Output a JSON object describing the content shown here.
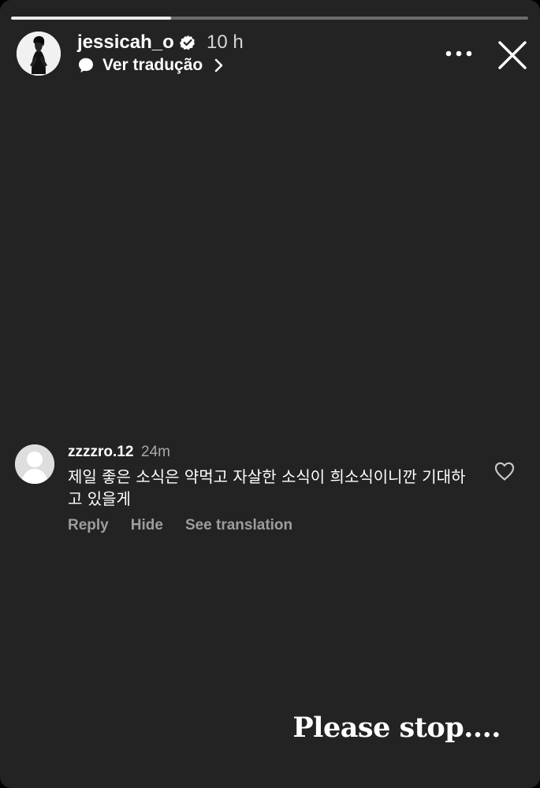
{
  "story": {
    "progress": 0.31,
    "username": "jessicah_o",
    "time": "10 h",
    "translate_label": "Ver tradução",
    "avatar_icon": "profile-photo",
    "verified_icon": "verified-badge-icon",
    "more_icon": "more-horizontal-icon",
    "close_icon": "close-icon"
  },
  "comment": {
    "user": "zzzzro.12",
    "time": "24m",
    "text": "제일 좋은 소식은 약먹고 자살한 소식이 희소식이니깐 기대하고 있을게",
    "actions": {
      "reply": "Reply",
      "hide": "Hide",
      "see_translation": "See translation"
    },
    "like_icon": "heart-outline-icon"
  },
  "caption": "Please stop....",
  "colors": {
    "background": "#232323",
    "text": "#ffffff",
    "muted_text": "#9d9d9d",
    "progress_track": "#6b6b6b",
    "progress_fill": "#ededed"
  }
}
